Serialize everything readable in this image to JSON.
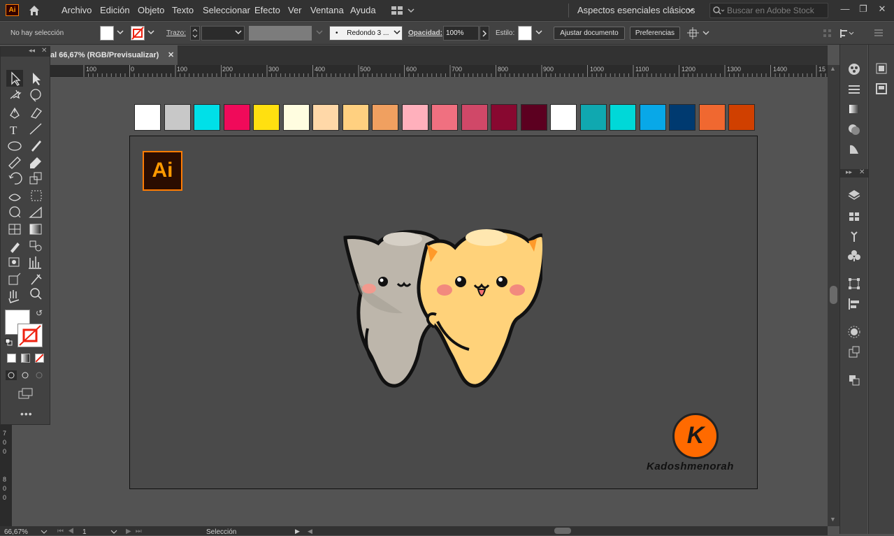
{
  "app": {
    "logo": "Ai",
    "menu": [
      "Archivo",
      "Edición",
      "Objeto",
      "Texto",
      "Seleccionar",
      "Efecto",
      "Ver",
      "Ventana",
      "Ayuda"
    ],
    "workspace": "Aspectos esenciales clásicos",
    "stock_search_placeholder": "Buscar en Adobe Stock"
  },
  "control_bar": {
    "selection": "No hay selección",
    "stroke_label": "Trazo:",
    "brush": "Redondo 3 ...",
    "opacity_label": "Opacidad:",
    "opacity_value": "100%",
    "style_label": "Estilo:",
    "fit_button": "Ajustar documento",
    "prefs_button": "Preferencias"
  },
  "document": {
    "tab_title": "al 66,67% (RGB/Previsualizar)"
  },
  "ruler": {
    "h_labels": [
      "100",
      "0",
      "100",
      "200",
      "300",
      "400",
      "500",
      "600",
      "700",
      "800",
      "900",
      "1000",
      "1100",
      "1200",
      "1300",
      "1400",
      "15"
    ],
    "v_labels": [
      "7",
      "0",
      "0",
      "8",
      "0",
      "0"
    ]
  },
  "swatches": [
    "#ffffff",
    "#c8c8c8",
    "#00e0e8",
    "#f00a5a",
    "#ffe010",
    "#fffde0",
    "#ffd8a8",
    "#ffd080",
    "#f0a060",
    "#ffb0bc",
    "#f07080",
    "#d04868",
    "#880830",
    "#5c0020",
    "#ffffff",
    "#10a8b0",
    "#00d8d8",
    "#08a8e8",
    "#003a70",
    "#f06830",
    "#d04000"
  ],
  "artwork": {
    "badge_text": "Ai",
    "watermark_letter": "K",
    "watermark_name": "Kadoshmenorah"
  },
  "status_bar": {
    "zoom": "66,67%",
    "artboard_number": "1",
    "tool": "Selección"
  },
  "colors": {
    "accent": "#ff7c00",
    "cat_orange": "#ffd27a",
    "cat_gray": "#bdb6ab"
  }
}
